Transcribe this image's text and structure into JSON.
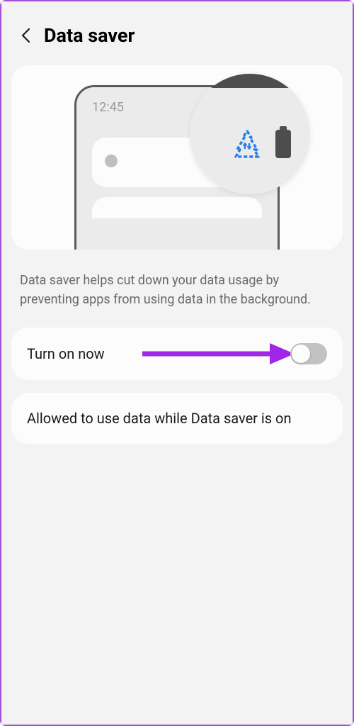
{
  "header": {
    "title": "Data saver"
  },
  "illustration": {
    "time": "12:45"
  },
  "description": "Data saver helps cut down your data usage by preventing apps from using data in the background.",
  "toggle": {
    "label": "Turn on now",
    "enabled": false
  },
  "option": {
    "label": "Allowed to use data while Data saver is on"
  },
  "colors": {
    "accent_purple": "#a226e8",
    "icon_blue": "#2b7de9"
  }
}
